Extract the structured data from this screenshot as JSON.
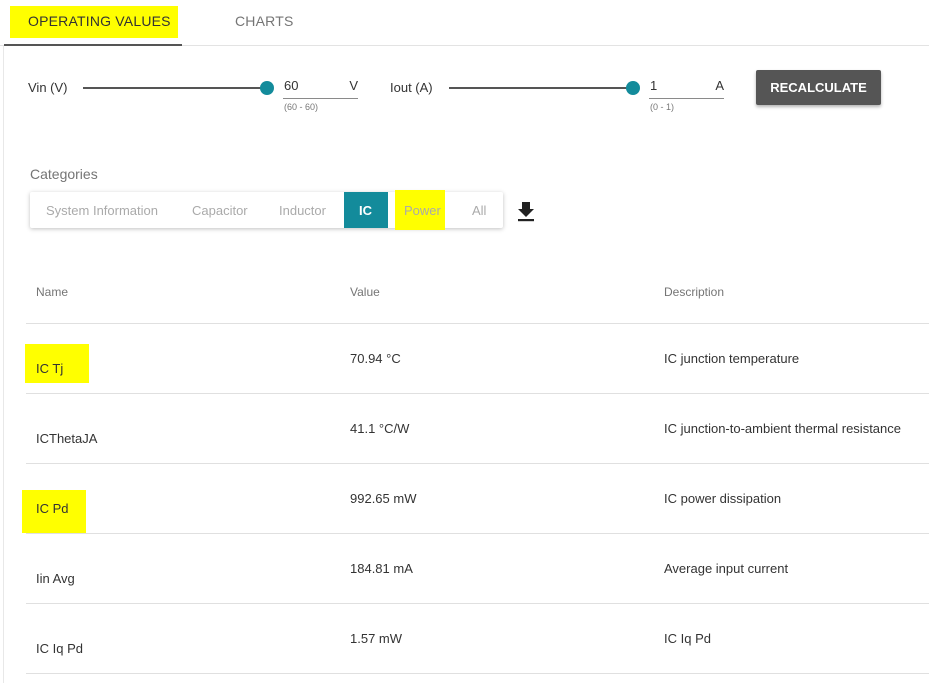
{
  "colors": {
    "highlight": "#ffff00",
    "accent": "#138b9b",
    "button": "#555555"
  },
  "tabs": [
    {
      "label": "OPERATING VALUES",
      "active": true
    },
    {
      "label": "CHARTS",
      "active": false
    }
  ],
  "inputs": {
    "vin": {
      "label": "Vin (V)",
      "value": "60",
      "unit": "V",
      "range": "(60 - 60)",
      "slider_fraction": 1.0
    },
    "iout": {
      "label": "Iout (A)",
      "value": "1",
      "unit": "A",
      "range": "(0 - 1)",
      "slider_fraction": 1.0
    },
    "recalculate_label": "RECALCULATE"
  },
  "categories": {
    "title": "Categories",
    "items": [
      "System Information",
      "Capacitor",
      "Inductor",
      "IC",
      "Power",
      "All"
    ],
    "active": "IC",
    "download_icon": "download-icon"
  },
  "table": {
    "headers": {
      "name": "Name",
      "value": "Value",
      "description": "Description"
    },
    "rows": [
      {
        "name": "IC Tj",
        "value": "70.94 °C",
        "description": "IC junction temperature"
      },
      {
        "name": "ICThetaJA",
        "value": "41.1 °C/W",
        "description": "IC junction-to-ambient thermal resistance"
      },
      {
        "name": "IC Pd",
        "value": "992.65 mW",
        "description": "IC power dissipation"
      },
      {
        "name": "Iin Avg",
        "value": "184.81 mA",
        "description": "Average input current"
      },
      {
        "name": "IC Iq Pd",
        "value": "1.57 mW",
        "description": "IC Iq Pd"
      }
    ]
  }
}
